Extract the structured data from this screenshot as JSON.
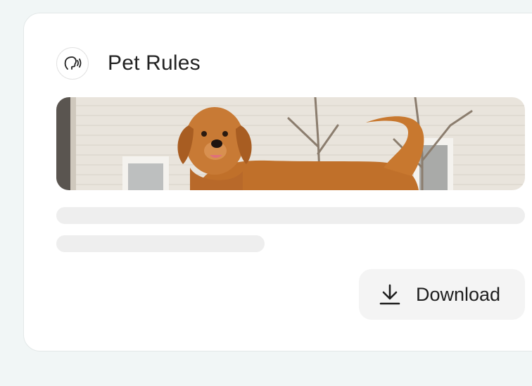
{
  "card": {
    "title": "Pet Rules",
    "avatar_icon": "speaking-head-icon",
    "image_icon": "golden-retriever-photo"
  },
  "actions": {
    "download_label": "Download",
    "download_icon": "download-icon"
  },
  "colors": {
    "background": "#f1f6f6",
    "card": "#ffffff",
    "skeleton": "#eeeeee",
    "button": "#f4f4f4"
  }
}
